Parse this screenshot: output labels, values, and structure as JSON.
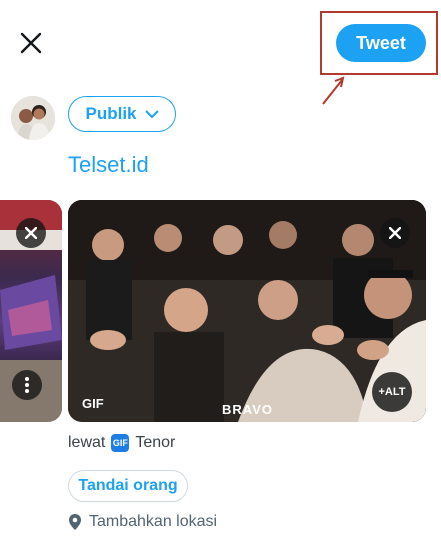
{
  "topbar": {
    "tweet_label": "Tweet"
  },
  "composer": {
    "audience_label": "Publik",
    "text": "Telset.id"
  },
  "media": {
    "gif_badge": "GIF",
    "caption": "BRAVO",
    "alt_label": "+ALT"
  },
  "attribution": {
    "via_label": "lewat",
    "gif_logo": "GIF",
    "provider": "Tenor"
  },
  "tag_label": "Tandai orang",
  "location_label": "Tambahkan lokasi",
  "colors": {
    "accent": "#1da1f2",
    "annotation": "#b23a2c"
  }
}
